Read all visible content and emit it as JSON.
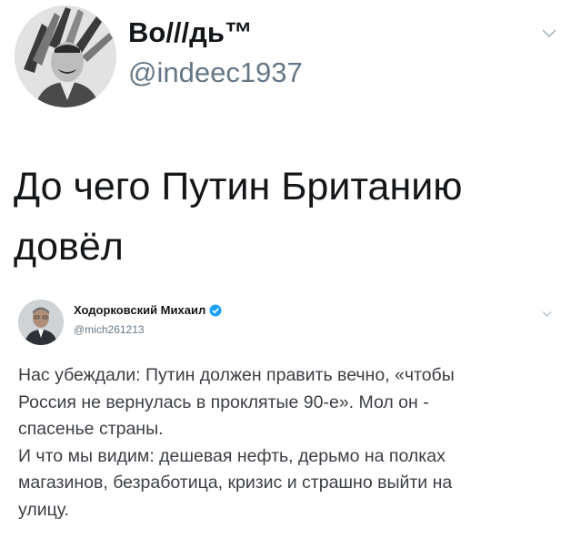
{
  "outer_tweet": {
    "author_name": "Во///дь™",
    "handle": "@indeec1937",
    "avatar_icon": "avatar-portrait-headdress",
    "menu_icon": "chevron-down-icon",
    "text_lines": [
      "До чего Путин Британию",
      "довёл"
    ]
  },
  "quoted_tweet": {
    "author_name": "Ходорковский Михаил",
    "verified_icon": "verified-badge-icon",
    "handle": "@mich261213",
    "avatar_icon": "avatar-portrait",
    "menu_icon": "chevron-down-icon",
    "text_lines": [
      "Нас убеждали: Путин должен править вечно, «чтобы",
      "Россия не вернулась в проклятые 90-е». Мол  он -",
      "спасенье страны.",
      "И что мы видим: дешевая нефть, дерьмо на полках",
      "магазинов, безработица, кризис и страшно выйти на",
      "улицу."
    ]
  },
  "colors": {
    "text_primary": "#14171a",
    "text_secondary": "#657786",
    "verified_blue": "#1da1f2",
    "chevron": "#aab8c2"
  }
}
